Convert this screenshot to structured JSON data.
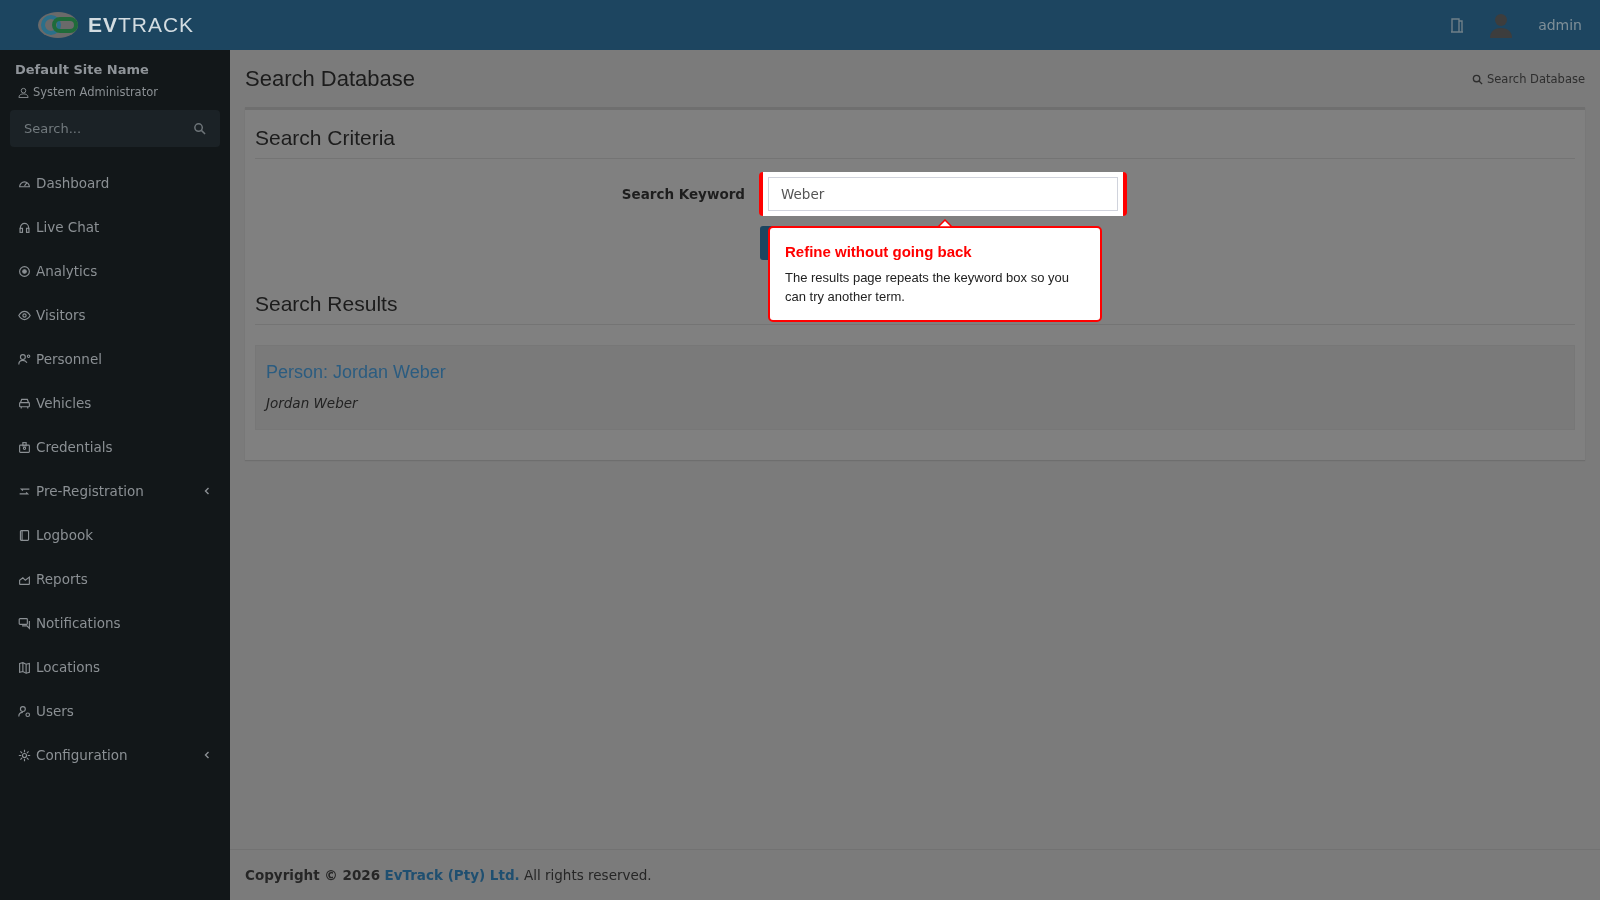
{
  "header": {
    "logo": "**EV**TRACK",
    "user": "admin"
  },
  "sidebar": {
    "site_name": "Default Site Name",
    "role": "System Administrator",
    "search": {
      "placeholder": "Search..."
    },
    "items": [
      {
        "label": "Dashboard",
        "expandable": false
      },
      {
        "label": "Live Chat",
        "expandable": false
      },
      {
        "label": "Analytics",
        "expandable": false
      },
      {
        "label": "Visitors",
        "expandable": false
      },
      {
        "label": "Personnel",
        "expandable": false
      },
      {
        "label": "Vehicles",
        "expandable": false
      },
      {
        "label": "Credentials",
        "expandable": false
      },
      {
        "label": "Pre-Registration",
        "expandable": true
      },
      {
        "label": "Logbook",
        "expandable": false
      },
      {
        "label": "Reports",
        "expandable": false
      },
      {
        "label": "Notifications",
        "expandable": false
      },
      {
        "label": "Locations",
        "expandable": false
      },
      {
        "label": "Users",
        "expandable": false
      },
      {
        "label": "Configuration",
        "expandable": true
      }
    ]
  },
  "page": {
    "title": "Search Database",
    "breadcrumb": "Search Database"
  },
  "criteria": {
    "heading": "Search Criteria",
    "field_label": "Search Keyword",
    "value": "Weber"
  },
  "callout": {
    "title": "Refine without going back",
    "text": "The results page repeats the keyword box so you can try another term."
  },
  "results": {
    "heading": "Search Results",
    "items": [
      {
        "title": "Person: Jordan Weber",
        "subtitle": "Jordan Weber"
      }
    ]
  },
  "footer": {
    "prefix": "Copyright © 2026",
    "link": "EvTrack (Pty) Ltd.",
    "suffix": "All rights reserved."
  }
}
